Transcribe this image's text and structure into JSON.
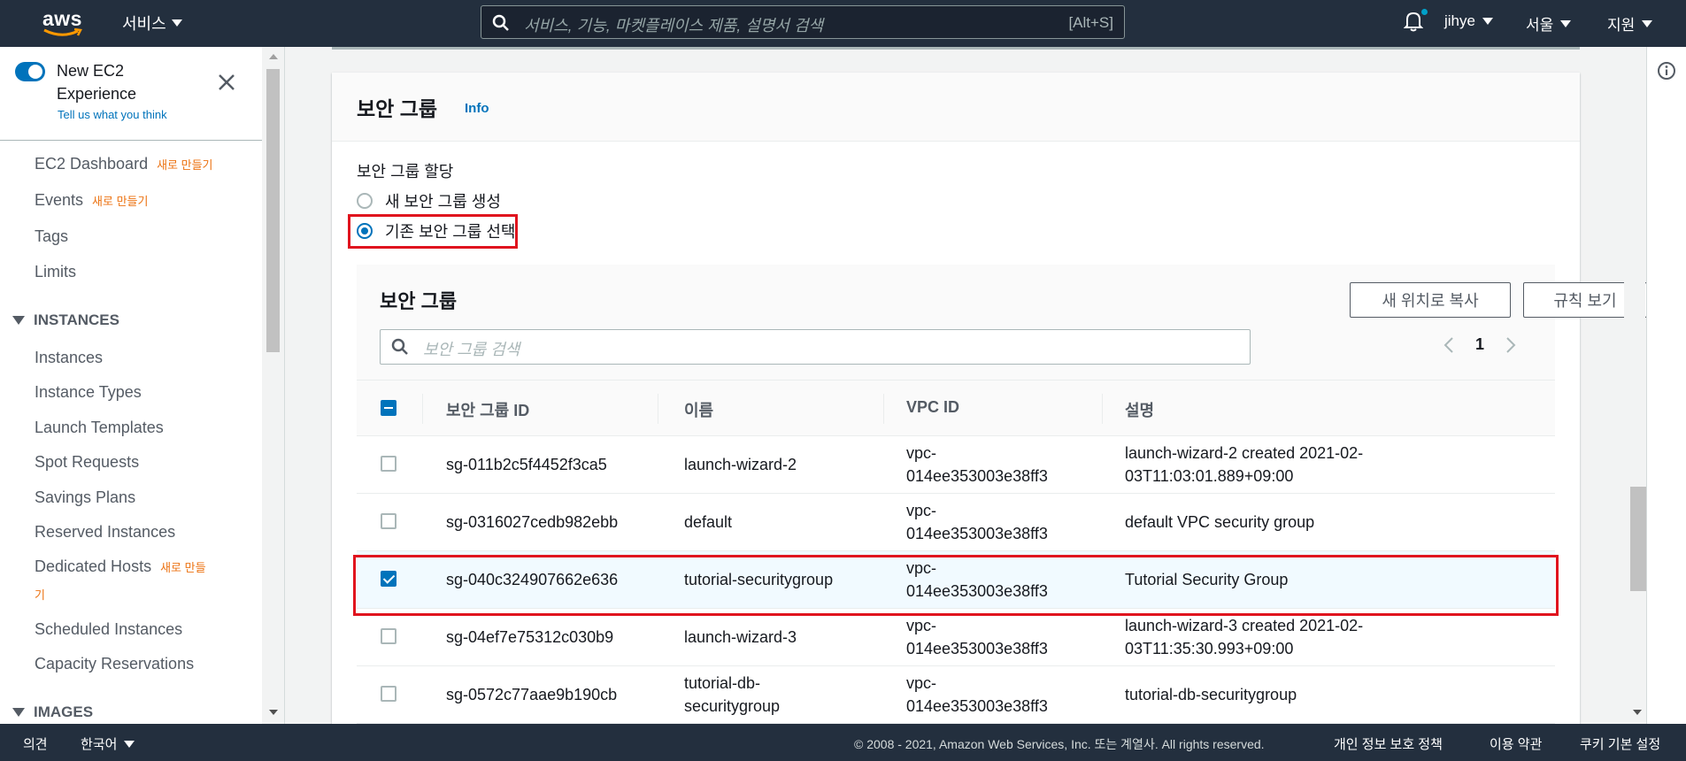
{
  "topnav": {
    "logo_text": "aws",
    "services_label": "서비스",
    "search_placeholder": "서비스, 기능, 마켓플레이스 제품, 설명서 검색",
    "search_shortcut": "[Alt+S]",
    "user_label": "jihye",
    "region_label": "서울",
    "support_label": "지원"
  },
  "sidebar": {
    "experience_title": "New EC2 Experience",
    "experience_link": "Tell us what you think",
    "items_top": [
      {
        "label": "EC2 Dashboard",
        "badge": "새로 만들기"
      },
      {
        "label": "Events",
        "badge": "새로 만들기"
      },
      {
        "label": "Tags",
        "badge": ""
      },
      {
        "label": "Limits",
        "badge": ""
      }
    ],
    "section_instances": "INSTANCES",
    "instance_items": [
      "Instances",
      "Instance Types",
      "Launch Templates",
      "Spot Requests",
      "Savings Plans",
      "Reserved Instances",
      "Dedicated Hosts",
      "Scheduled Instances",
      "Capacity Reservations"
    ],
    "dedicated_badge_line1": "새로 만들",
    "dedicated_badge_line2": "기",
    "section_images": "IMAGES"
  },
  "panel": {
    "title": "보안 그룹",
    "info_link": "Info",
    "assign_label": "보안 그룹 할당",
    "radio_create": "새 보안 그룹 생성",
    "radio_existing": "기존 보안 그룹 선택",
    "selected_radio": "radio_existing"
  },
  "sg_table": {
    "title": "보안 그룹",
    "copy_button": "새 위치로 복사",
    "rules_button": "규칙 보기",
    "search_placeholder": "보안 그룹 검색",
    "page_number": "1",
    "columns": [
      "보안 그룹 ID",
      "이름",
      "VPC ID",
      "설명"
    ],
    "rows": [
      {
        "id": "sg-011b2c5f4452f3ca5",
        "name_l1": "launch-wizard-2",
        "name_l2": "",
        "vpc_l1": "vpc-",
        "vpc_l2": "014ee353003e38ff3",
        "desc_l1": "launch-wizard-2 created 2021-02-",
        "desc_l2": "03T11:03:01.889+09:00",
        "checked": false
      },
      {
        "id": "sg-0316027cedb982ebb",
        "name_l1": "default",
        "name_l2": "",
        "vpc_l1": "vpc-",
        "vpc_l2": "014ee353003e38ff3",
        "desc_l1": "default VPC security group",
        "desc_l2": "",
        "checked": false
      },
      {
        "id": "sg-040c324907662e636",
        "name_l1": "tutorial-securitygroup",
        "name_l2": "",
        "vpc_l1": "vpc-",
        "vpc_l2": "014ee353003e38ff3",
        "desc_l1": "Tutorial Security Group",
        "desc_l2": "",
        "checked": true
      },
      {
        "id": "sg-04ef7e75312c030b9",
        "name_l1": "launch-wizard-3",
        "name_l2": "",
        "vpc_l1": "vpc-",
        "vpc_l2": "014ee353003e38ff3",
        "desc_l1": "launch-wizard-3 created 2021-02-",
        "desc_l2": "03T11:35:30.993+09:00",
        "checked": false
      },
      {
        "id": "sg-0572c77aae9b190cb",
        "name_l1": "tutorial-db-",
        "name_l2": "securitygroup",
        "vpc_l1": "vpc-",
        "vpc_l2": "014ee353003e38ff3",
        "desc_l1": "tutorial-db-securitygroup",
        "desc_l2": "",
        "checked": false
      }
    ]
  },
  "footer": {
    "feedback": "의견",
    "language": "한국어",
    "copyright": "© 2008 - 2021, Amazon Web Services, Inc. 또는 계열사. All rights reserved.",
    "privacy": "개인 정보 보호 정책",
    "terms": "이용 약관",
    "cookies": "쿠키 기본 설정"
  },
  "colors": {
    "nav_bg": "#232f3e",
    "accent_blue": "#0073bb",
    "highlight_red": "#e0141e",
    "badge_orange": "#ec7211"
  },
  "icons": [
    "search-icon",
    "bell-icon",
    "close-icon",
    "info-icon",
    "chevron-left-icon",
    "chevron-right-icon"
  ]
}
